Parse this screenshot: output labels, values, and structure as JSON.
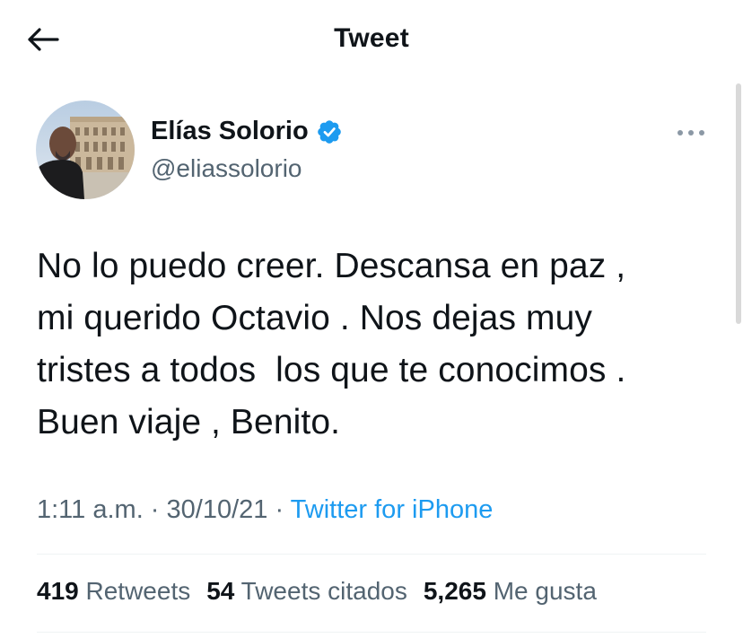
{
  "header": {
    "title": "Tweet",
    "back_icon": "arrow-left-icon"
  },
  "author": {
    "name": "Elías Solorio",
    "handle": "@eliassolorio",
    "verified_icon": "verified-badge-icon",
    "verified_color": "#1d9bf0"
  },
  "more_icon": "more-options-icon",
  "tweet": {
    "text": "No lo puedo creer. Descansa en paz ,\nmi querido Octavio . Nos dejas muy\ntristes a todos  los que te conocimos .\nBuen viaje , Benito."
  },
  "meta": {
    "time": "1:11 a.m.",
    "separator": " · ",
    "date": "30/10/21",
    "source": "Twitter for iPhone"
  },
  "stats": {
    "retweets_count": "419",
    "retweets_label": "Retweets",
    "quotes_count": "54",
    "quotes_label": "Tweets citados",
    "likes_count": "5,265",
    "likes_label": "Me gusta"
  },
  "colors": {
    "text_primary": "#0f1419",
    "text_secondary": "#536471",
    "link": "#1d9bf0",
    "divider": "#eff3f4"
  }
}
